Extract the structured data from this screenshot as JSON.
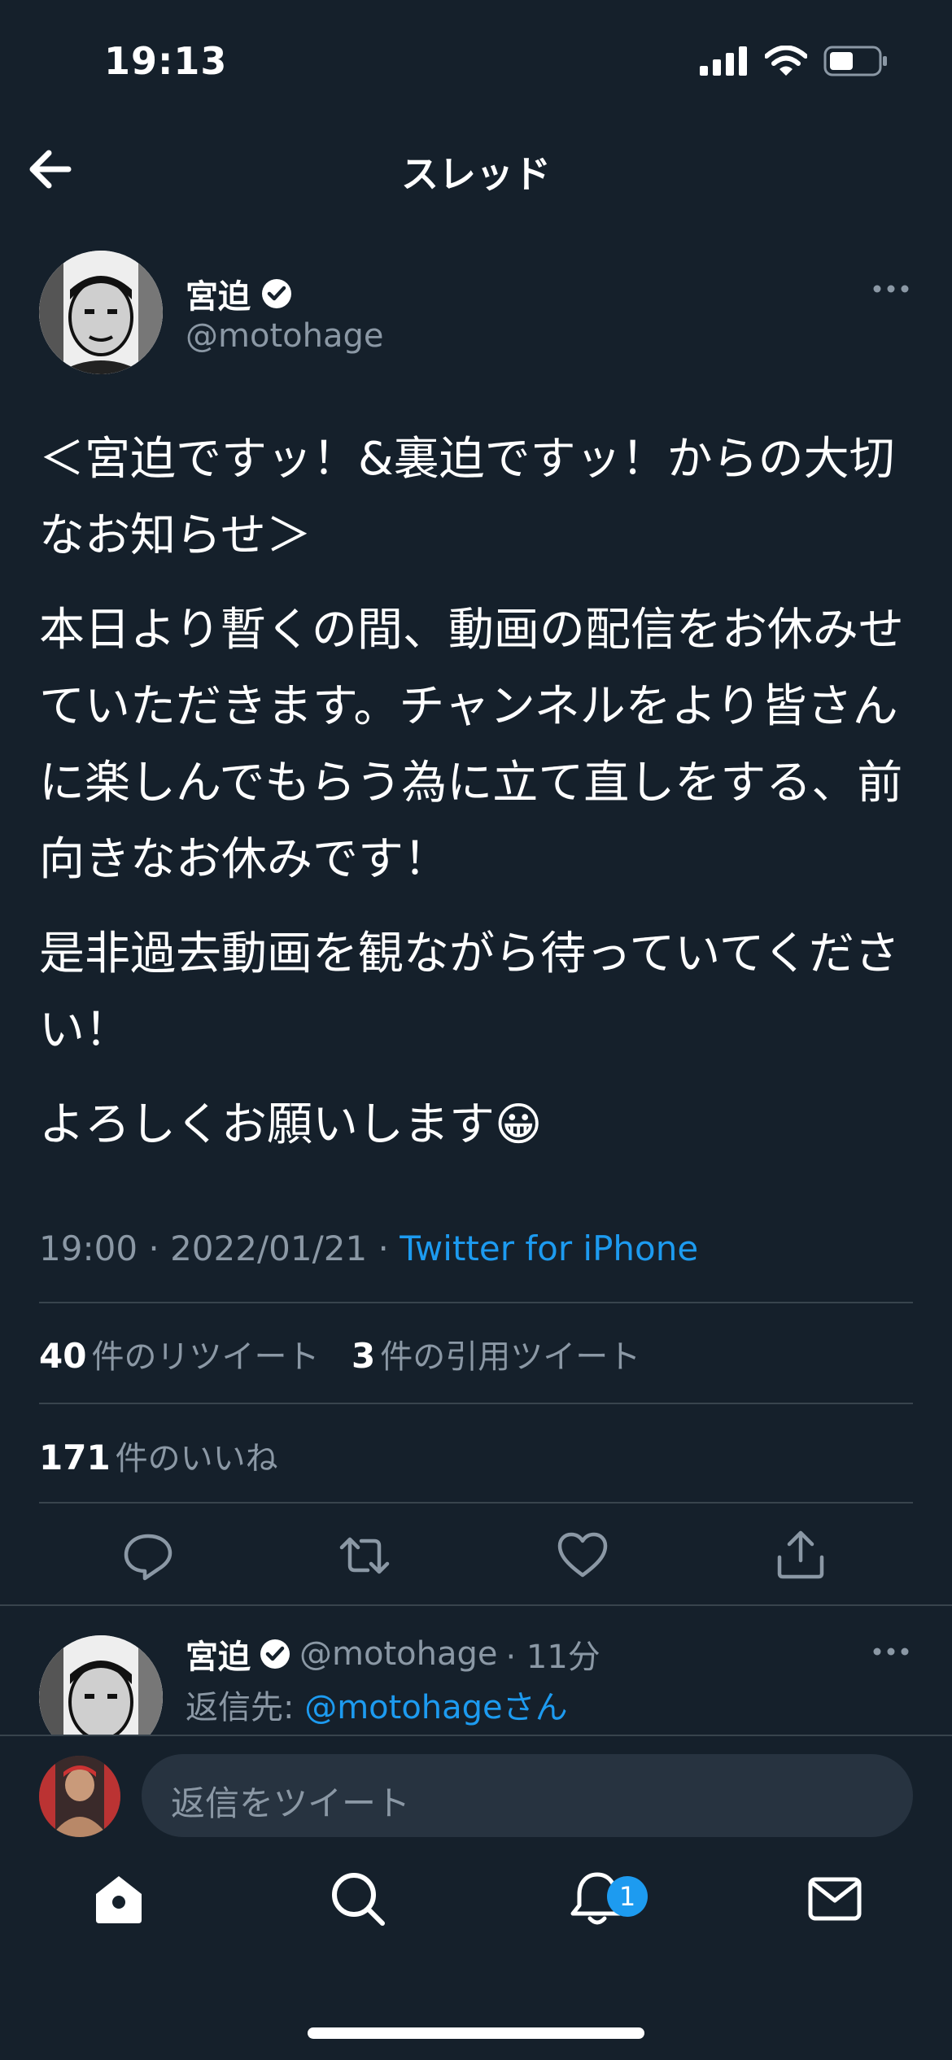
{
  "status_bar": {
    "time": "19:13",
    "icons": [
      "signal-icon",
      "wifi-icon",
      "battery-icon"
    ]
  },
  "header": {
    "title": "スレッド",
    "back_icon": "arrow-left-icon"
  },
  "tweet": {
    "author_name": "宮迫",
    "verified": true,
    "author_handle": "@motohage",
    "body": [
      "＜宮迫ですッ！&裏迫ですッ！からの大切なお知らせ＞",
      "本日より暫くの間、動画の配信をお休みせていただきます。チャンネルをより皆さんに楽しんでもらう為に立て直しをする、前向きなお休みです！",
      "是非過去動画を観ながら待っていてください！",
      "よろしくお願いします😀"
    ],
    "timestamp": "19:00 · 2022/01/21 · ",
    "source": "Twitter for iPhone",
    "retweets_count": "40",
    "retweets_label": "件のリツイート",
    "quotes_count": "3",
    "quotes_label": "件の引用ツイート",
    "likes_count": "171",
    "likes_label": "件のいいね"
  },
  "actions": [
    "reply-icon",
    "retweet-icon",
    "like-icon",
    "share-icon"
  ],
  "reply": {
    "author_name": "宮迫",
    "author_handle": "@motohage",
    "time_ago": "· 11分",
    "reply_to_label": "返信先: ",
    "reply_to_handle": "@motohageさん"
  },
  "compose": {
    "placeholder": "返信をツイート"
  },
  "tab_bar": {
    "items": [
      "home-icon",
      "search-icon",
      "notifications-icon",
      "messages-icon"
    ],
    "notification_badge": "1"
  },
  "colors": {
    "background": "#15202b",
    "accent": "#1d9bf0",
    "secondary_text": "#8b98a5",
    "divider": "#38444d"
  }
}
